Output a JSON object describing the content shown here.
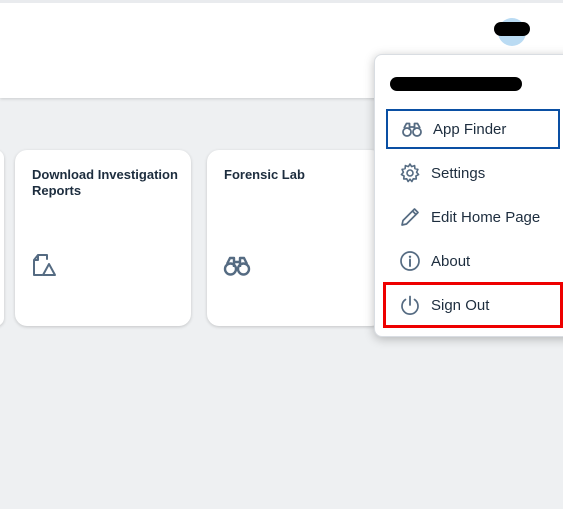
{
  "header": {
    "user_avatar_icon": "user-avatar-icon"
  },
  "tiles": [
    {
      "title": "Download Investigation Reports",
      "icon": "document-upload-icon"
    },
    {
      "title": "Forensic Lab",
      "icon": "binoculars-icon"
    }
  ],
  "user_menu": {
    "items": [
      {
        "label": "App Finder",
        "icon": "binoculars-icon",
        "state": "focused"
      },
      {
        "label": "Settings",
        "icon": "gear-icon"
      },
      {
        "label": "Edit Home Page",
        "icon": "pencil-icon"
      },
      {
        "label": "About",
        "icon": "info-icon"
      },
      {
        "label": "Sign Out",
        "icon": "power-icon",
        "state": "highlighted"
      }
    ]
  },
  "colors": {
    "background": "#eef0f2",
    "text": "#1d2d3e",
    "icon": "#556b82",
    "focus_border": "#0a4fa3",
    "highlight_box": "#ee0000"
  }
}
